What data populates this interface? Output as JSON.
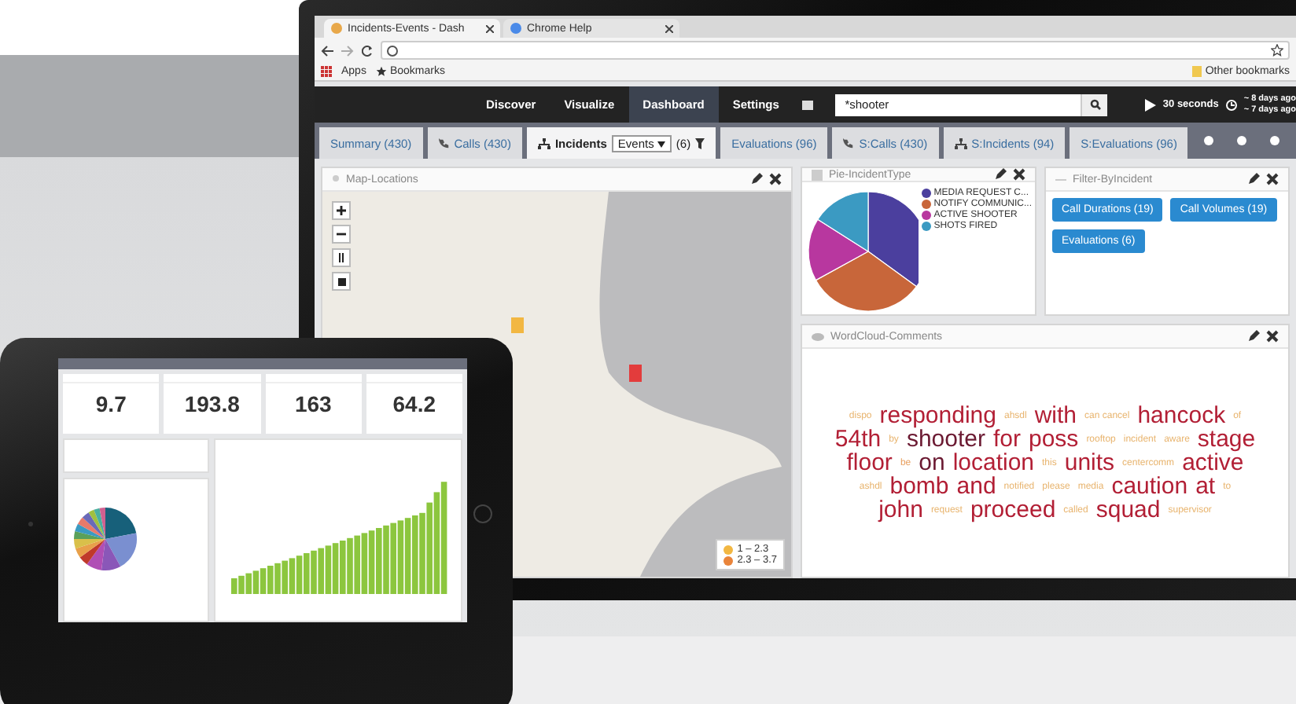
{
  "browser": {
    "tabs": [
      {
        "title": "Incidents-Events - Dash",
        "selected": true
      },
      {
        "title": "Chrome Help",
        "selected": false
      }
    ],
    "bookmarks": {
      "apps": "Apps",
      "bookmarks": "Bookmarks",
      "other": "Other bookmarks"
    }
  },
  "nav": {
    "items": [
      {
        "label": "Discover",
        "selected": false
      },
      {
        "label": "Visualize",
        "selected": false
      },
      {
        "label": "Dashboard",
        "selected": true
      },
      {
        "label": "Settings",
        "selected": false
      }
    ],
    "search": {
      "value": "*shooter"
    },
    "refresh": "30 seconds",
    "time_range": [
      "~ 8 days ago",
      "~ 7 days ago"
    ]
  },
  "dashboard_tabs": [
    {
      "label": "Summary (430)",
      "kind": "plain",
      "selected": false
    },
    {
      "label": "Calls (430)",
      "kind": "phone",
      "selected": false
    },
    {
      "label": "Incidents",
      "kind": "dropdown",
      "selected": true,
      "select": "Events",
      "count": "(6)"
    },
    {
      "label": "Evaluations (96)",
      "kind": "plain",
      "selected": false
    },
    {
      "label": "S:Calls (430)",
      "kind": "phone",
      "selected": false
    },
    {
      "label": "S:Incidents (94)",
      "kind": "network",
      "selected": false
    },
    {
      "label": "S:Evaluations (96)",
      "kind": "plain",
      "selected": false
    }
  ],
  "map_panel": {
    "title": "Map-Locations",
    "legend": [
      {
        "label": "1 – 2.3",
        "color": "#f2b742"
      },
      {
        "label": "2.3 – 3.7",
        "color": "#e9843a"
      }
    ]
  },
  "pie_panel": {
    "title": "Pie-IncidentType",
    "legend": [
      {
        "label": "MEDIA REQUEST C...",
        "color": "#4b3f9e"
      },
      {
        "label": "NOTIFY COMMUNIC...",
        "color": "#c8663a"
      },
      {
        "label": "ACTIVE SHOOTER",
        "color": "#b8379f"
      },
      {
        "label": "SHOTS FIRED",
        "color": "#3b9ac2"
      }
    ]
  },
  "filter_panel": {
    "title": "Filter-ByIncident",
    "buttons": [
      "Call Durations (19)",
      "Call Volumes (19)",
      "Evaluations (6)"
    ]
  },
  "wordcloud_panel": {
    "title": "WordCloud-Comments",
    "words": [
      {
        "text": "dispo",
        "kind": "minor",
        "color": "#e8b46e"
      },
      {
        "text": "responding",
        "kind": "major",
        "color": "#b21f35"
      },
      {
        "text": "ahsdl",
        "kind": "minor",
        "color": "#e8b46e"
      },
      {
        "text": "with",
        "kind": "major",
        "color": "#b21f35"
      },
      {
        "text": "can cancel",
        "kind": "minor",
        "color": "#e8b46e"
      },
      {
        "text": "hancock",
        "kind": "major",
        "color": "#b21f35"
      },
      {
        "text": "of",
        "kind": "minor",
        "color": "#e8b46e"
      },
      {
        "text": "54th",
        "kind": "major",
        "color": "#b21f35"
      },
      {
        "text": "by",
        "kind": "minor",
        "color": "#e8b46e"
      },
      {
        "text": "shooter",
        "kind": "major",
        "color": "#6b1a32"
      },
      {
        "text": "for",
        "kind": "major",
        "color": "#b21f35"
      },
      {
        "text": "poss",
        "kind": "major",
        "color": "#b21f35"
      },
      {
        "text": "rooftop",
        "kind": "minor",
        "color": "#e8b46e"
      },
      {
        "text": "incident",
        "kind": "minor",
        "color": "#e8b46e"
      },
      {
        "text": "aware",
        "kind": "minor",
        "color": "#e8b46e"
      },
      {
        "text": "stage",
        "kind": "major",
        "color": "#b21f35"
      },
      {
        "text": "floor",
        "kind": "major",
        "color": "#b21f35"
      },
      {
        "text": "be",
        "kind": "minor",
        "color": "#e8a060"
      },
      {
        "text": "on",
        "kind": "major",
        "color": "#6b1a32"
      },
      {
        "text": "location",
        "kind": "major",
        "color": "#b21f35"
      },
      {
        "text": "this",
        "kind": "minor",
        "color": "#e8b46e"
      },
      {
        "text": "units",
        "kind": "major",
        "color": "#b21f35"
      },
      {
        "text": "centercomm",
        "kind": "minor",
        "color": "#e8b46e"
      },
      {
        "text": "active",
        "kind": "major",
        "color": "#b21f35"
      },
      {
        "text": "ashdl",
        "kind": "minor",
        "color": "#e8b46e"
      },
      {
        "text": "bomb",
        "kind": "major",
        "color": "#b21f35"
      },
      {
        "text": "and",
        "kind": "major",
        "color": "#b21f35"
      },
      {
        "text": "notified",
        "kind": "minor",
        "color": "#e8b46e"
      },
      {
        "text": "please",
        "kind": "minor",
        "color": "#e8b46e"
      },
      {
        "text": "media",
        "kind": "minor",
        "color": "#e8b46e"
      },
      {
        "text": "caution",
        "kind": "major",
        "color": "#b21f35"
      },
      {
        "text": "at",
        "kind": "major",
        "color": "#b21f35"
      },
      {
        "text": "to",
        "kind": "minor",
        "color": "#e8b46e"
      },
      {
        "text": "john",
        "kind": "major",
        "color": "#b21f35"
      },
      {
        "text": "request",
        "kind": "minor",
        "color": "#e8b46e"
      },
      {
        "text": "proceed",
        "kind": "major",
        "color": "#b21f35"
      },
      {
        "text": "called",
        "kind": "minor",
        "color": "#e8b46e"
      },
      {
        "text": "squad",
        "kind": "major",
        "color": "#b21f35"
      },
      {
        "text": "supervisor",
        "kind": "minor",
        "color": "#e8b46e"
      }
    ]
  },
  "tablet": {
    "metrics": [
      {
        "value": "9.7"
      },
      {
        "value": "193.8"
      },
      {
        "value": "163"
      },
      {
        "value": "64.2"
      }
    ]
  }
}
